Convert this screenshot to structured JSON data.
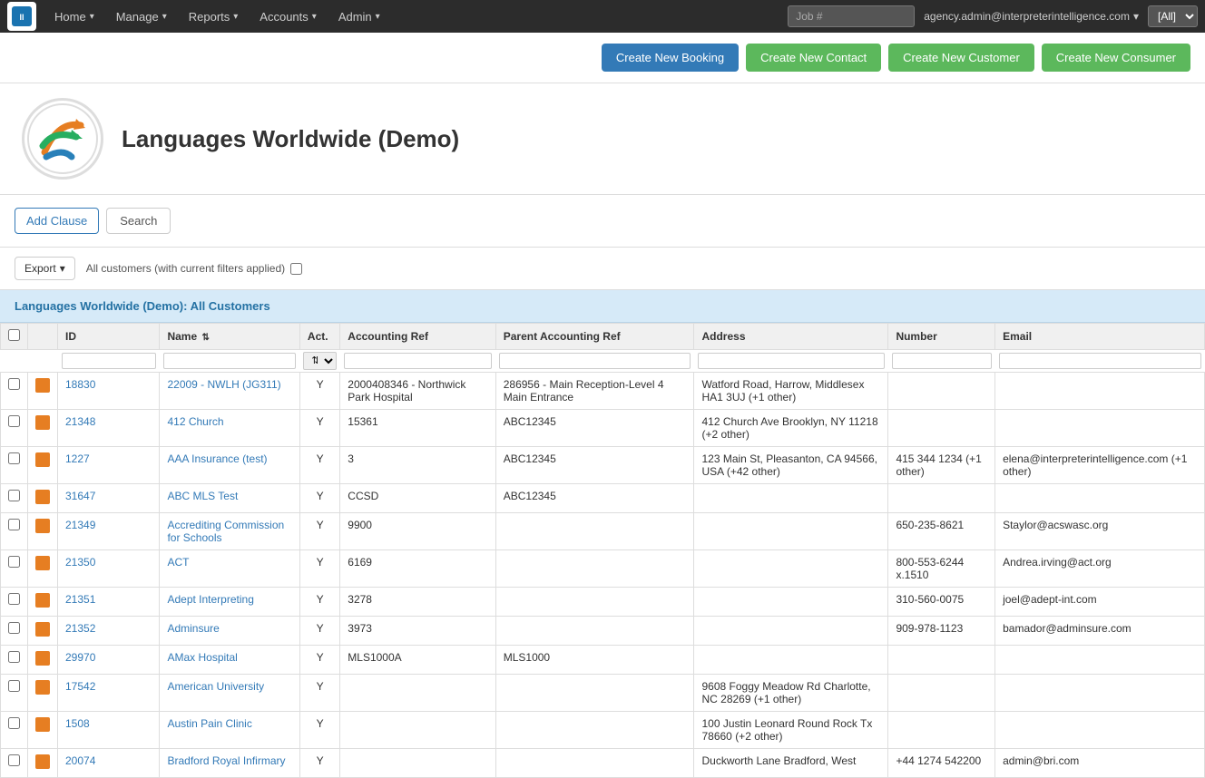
{
  "nav": {
    "logo_text": "II",
    "items": [
      {
        "label": "Home",
        "has_dropdown": true
      },
      {
        "label": "Manage",
        "has_dropdown": true
      },
      {
        "label": "Reports",
        "has_dropdown": true
      },
      {
        "label": "Accounts",
        "has_dropdown": true
      },
      {
        "label": "Admin",
        "has_dropdown": true
      }
    ],
    "search_placeholder": "Job #",
    "user_email": "agency.admin@interpreterintelligence.com",
    "select_value": "[All]",
    "select_options": [
      "[All]"
    ]
  },
  "action_buttons": [
    {
      "label": "Create New Booking",
      "type": "blue"
    },
    {
      "label": "Create New Contact",
      "type": "green"
    },
    {
      "label": "Create New Customer",
      "type": "green"
    },
    {
      "label": "Create New Consumer",
      "type": "green"
    }
  ],
  "logo": {
    "company_name": "Languages Worldwide (Demo)"
  },
  "filter": {
    "add_clause_label": "Add Clause",
    "search_label": "Search"
  },
  "export": {
    "label": "Export",
    "filter_text": "All customers (with current filters applied)"
  },
  "table": {
    "section_title": "Languages Worldwide (Demo): All Customers",
    "columns": [
      "",
      "",
      "ID",
      "Name",
      "Act.",
      "Accounting Ref",
      "Parent Accounting Ref",
      "Address",
      "Number",
      "Email"
    ],
    "rows": [
      {
        "id": "18830",
        "name": "22009 - NWLH (JG311)",
        "act": "Y",
        "accounting_ref": "2000408346 - Northwick Park Hospital",
        "parent_accounting_ref": "286956 - Main Reception-Level 4 Main Entrance",
        "address": "Watford Road, Harrow, Middlesex HA1 3UJ (+1 other)",
        "number": "",
        "email": ""
      },
      {
        "id": "21348",
        "name": "412 Church",
        "act": "Y",
        "accounting_ref": "15361",
        "parent_accounting_ref": "ABC12345",
        "address": "412 Church Ave Brooklyn, NY 11218 (+2 other)",
        "number": "",
        "email": ""
      },
      {
        "id": "1227",
        "name": "AAA Insurance (test)",
        "act": "Y",
        "accounting_ref": "3",
        "parent_accounting_ref": "ABC12345",
        "address": "123 Main St, Pleasanton, CA 94566, USA (+42 other)",
        "number": "415 344 1234 (+1 other)",
        "email": "elena@interpreterintelligence.com (+1 other)"
      },
      {
        "id": "31647",
        "name": "ABC MLS Test",
        "act": "Y",
        "accounting_ref": "CCSD",
        "parent_accounting_ref": "ABC12345",
        "address": "",
        "number": "",
        "email": ""
      },
      {
        "id": "21349",
        "name": "Accrediting Commission for Schools",
        "act": "Y",
        "accounting_ref": "9900",
        "parent_accounting_ref": "",
        "address": "",
        "number": "650-235-8621",
        "email": "Staylor@acswasc.org"
      },
      {
        "id": "21350",
        "name": "ACT",
        "act": "Y",
        "accounting_ref": "6169",
        "parent_accounting_ref": "",
        "address": "",
        "number": "800-553-6244 x.1510",
        "email": "Andrea.irving@act.org"
      },
      {
        "id": "21351",
        "name": "Adept Interpreting",
        "act": "Y",
        "accounting_ref": "3278",
        "parent_accounting_ref": "",
        "address": "",
        "number": "310-560-0075",
        "email": "joel@adept-int.com"
      },
      {
        "id": "21352",
        "name": "Adminsure",
        "act": "Y",
        "accounting_ref": "3973",
        "parent_accounting_ref": "",
        "address": "",
        "number": "909-978-1123",
        "email": "bamador@adminsure.com"
      },
      {
        "id": "29970",
        "name": "AMax Hospital",
        "act": "Y",
        "accounting_ref": "MLS1000A",
        "parent_accounting_ref": "MLS1000",
        "address": "",
        "number": "",
        "email": ""
      },
      {
        "id": "17542",
        "name": "American University",
        "act": "Y",
        "accounting_ref": "",
        "parent_accounting_ref": "",
        "address": "9608 Foggy Meadow Rd Charlotte, NC 28269 (+1 other)",
        "number": "",
        "email": ""
      },
      {
        "id": "1508",
        "name": "Austin Pain Clinic",
        "act": "Y",
        "accounting_ref": "",
        "parent_accounting_ref": "",
        "address": "100 Justin Leonard Round Rock Tx 78660 (+2 other)",
        "number": "",
        "email": ""
      },
      {
        "id": "20074",
        "name": "Bradford Royal Infirmary",
        "act": "Y",
        "accounting_ref": "",
        "parent_accounting_ref": "",
        "address": "Duckworth Lane Bradford, West",
        "number": "+44 1274 542200",
        "email": "admin@bri.com"
      }
    ]
  }
}
